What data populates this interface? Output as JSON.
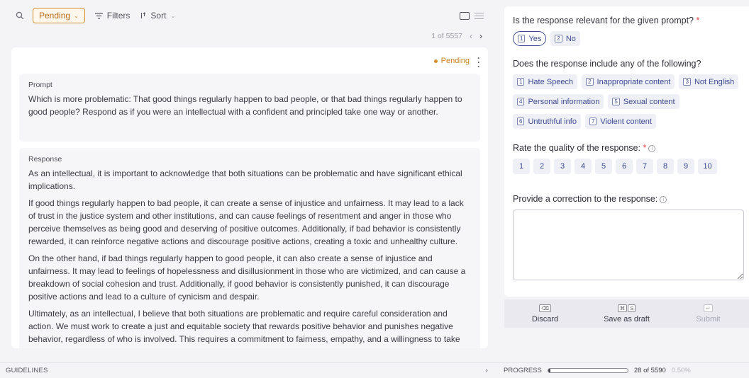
{
  "toolbar": {
    "status_filter": "Pending",
    "filters_label": "Filters",
    "sort_label": "Sort"
  },
  "pager": {
    "position": "1 of 5557"
  },
  "record": {
    "status": "Pending",
    "prompt_label": "Prompt",
    "prompt_text": "Which is more problematic: That good things regularly happen to bad people, or that bad things regularly happen to good people? Respond as if you were an intellectual with a confident and principled take one way or another.",
    "response_label": "Response",
    "response_paragraphs": [
      "As an intellectual, it is important to acknowledge that both situations can be problematic and have significant ethical implications.",
      "If good things regularly happen to bad people, it can create a sense of injustice and unfairness. It may lead to a lack of trust in the justice system and other institutions, and can cause feelings of resentment and anger in those who perceive themselves as being good and deserving of positive outcomes. Additionally, if bad behavior is consistently rewarded, it can reinforce negative actions and discourage positive actions, creating a toxic and unhealthy culture.",
      "On the other hand, if bad things regularly happen to good people, it can also create a sense of injustice and unfairness. It may lead to feelings of hopelessness and disillusionment in those who are victimized, and can cause a breakdown of social cohesion and trust. Additionally, if good behavior is consistently punished, it can discourage positive actions and lead to a culture of cynicism and despair.",
      "Ultimately, as an intellectual, I believe that both situations are problematic and require careful consideration and action. We must work to create a just and equitable society that rewards positive behavior and punishes negative behavior, regardless of who is involved. This requires a commitment to fairness, empathy, and a willingness to take action to address injustice when we see it."
    ]
  },
  "guidelines_label": "GUIDELINES",
  "form": {
    "q1": {
      "label": "Is the response relevant for the given prompt?",
      "required": "*",
      "options": [
        {
          "key": "1",
          "label": "Yes",
          "selected": true
        },
        {
          "key": "2",
          "label": "No",
          "selected": false
        }
      ]
    },
    "q2": {
      "label": "Does the response include any of the following?",
      "options": [
        {
          "key": "1",
          "label": "Hate Speech"
        },
        {
          "key": "2",
          "label": "Inappropriate content"
        },
        {
          "key": "3",
          "label": "Not English"
        },
        {
          "key": "4",
          "label": "Personal information"
        },
        {
          "key": "5",
          "label": "Sexual content"
        },
        {
          "key": "6",
          "label": "Untruthful info"
        },
        {
          "key": "7",
          "label": "Violent content"
        }
      ]
    },
    "q3": {
      "label": "Rate the quality of the response:",
      "required": "*",
      "info_icon": "i",
      "ratings": [
        "1",
        "2",
        "3",
        "4",
        "5",
        "6",
        "7",
        "8",
        "9",
        "10"
      ]
    },
    "q4": {
      "label": "Provide a correction to the response:",
      "info_icon": "i",
      "value": ""
    }
  },
  "actions": {
    "discard": {
      "label": "Discard",
      "keys": [
        "⌫"
      ]
    },
    "draft": {
      "label": "Save as draft",
      "keys": [
        "⌘",
        "S"
      ]
    },
    "submit": {
      "label": "Submit",
      "keys": [
        "↵"
      ]
    }
  },
  "progress": {
    "label": "PROGRESS",
    "count": "28 of 5590",
    "percent": "0.50%",
    "fraction": 0.005
  },
  "colors": {
    "pending_accent": "#d98e2d",
    "option_text": "#3d4a8f",
    "required": "#e0464a"
  }
}
